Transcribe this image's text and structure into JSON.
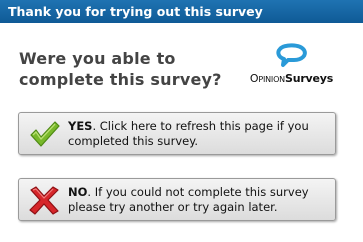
{
  "window": {
    "title": "Thank you for trying out this survey"
  },
  "prompt": {
    "question": "Were you able to complete this survey?"
  },
  "logo": {
    "part1": "Opinion",
    "part2": "Surveys",
    "icon": "speech-bubble-icon"
  },
  "buttons": {
    "yes": {
      "keyword": "YES",
      "text": ". Click here to refresh this page if you completed this survey.",
      "icon": "check-icon",
      "icon_color": "#78b82a"
    },
    "no": {
      "keyword": "NO",
      "text": ". If you could not complete this survey please try another or try again later.",
      "icon": "cross-icon",
      "icon_color": "#d6262a"
    }
  },
  "colors": {
    "titlebar": "#1563a5",
    "logo_blue": "#2a9ad8"
  }
}
